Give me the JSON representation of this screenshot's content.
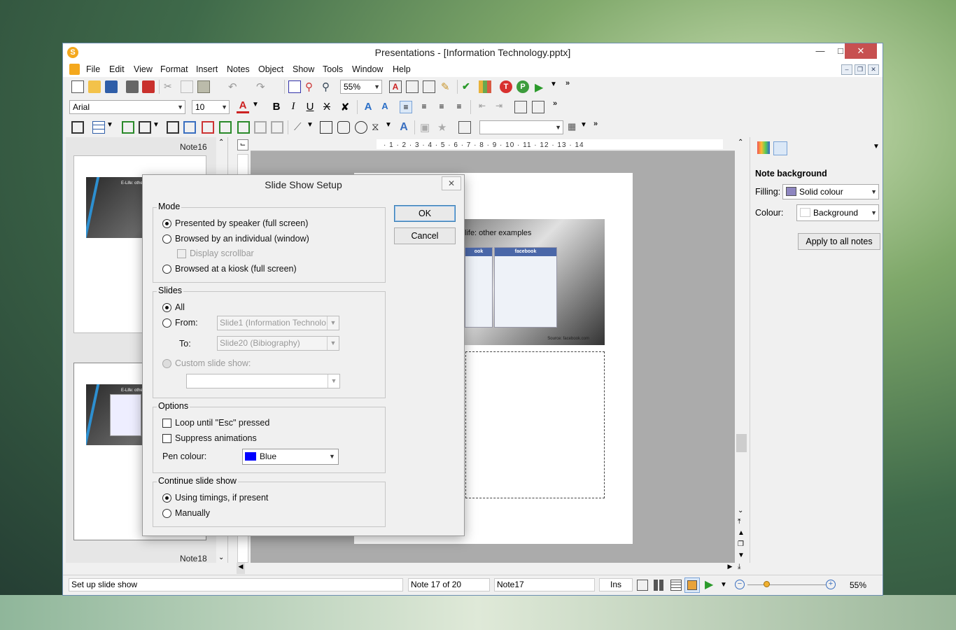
{
  "window": {
    "title": "Presentations - [Information Technology.pptx]",
    "app_icon": "S"
  },
  "menu": [
    "File",
    "Edit",
    "View",
    "Format",
    "Insert",
    "Notes",
    "Object",
    "Show",
    "Tools",
    "Window",
    "Help"
  ],
  "toolbar1": {
    "zoom": "55%"
  },
  "toolbar2": {
    "font": "Arial",
    "size": "10"
  },
  "left_pane": {
    "top_label": "Note16",
    "bottom_label": "Note18",
    "thumb1_title": "E-Life: other",
    "thumb2_title": "E-Life: othe"
  },
  "slide": {
    "title": "life: other examples",
    "fb_left_head": "ook",
    "fb_right_head": "facebook",
    "source": "Source: facebook.com"
  },
  "right_pane": {
    "heading": "Note background",
    "filling_label": "Filling:",
    "filling_value": "Solid colour",
    "colour_label": "Colour:",
    "colour_value": "Background",
    "apply_button": "Apply to all notes"
  },
  "dialog": {
    "title": "Slide Show Setup",
    "ok": "OK",
    "cancel": "Cancel",
    "mode": {
      "legend": "Mode",
      "opt1": "Presented by speaker (full screen)",
      "opt2": "Browsed by an individual (window)",
      "opt2_sub": "Display scrollbar",
      "opt3": "Browsed at a kiosk (full screen)"
    },
    "slides": {
      "legend": "Slides",
      "all": "All",
      "from": "From:",
      "from_value": "Slide1 (Information Technolo",
      "to": "To:",
      "to_value": "Slide20 (Bibiography)",
      "custom": "Custom slide show:"
    },
    "options": {
      "legend": "Options",
      "loop": "Loop until \"Esc\" pressed",
      "suppress": "Suppress animations",
      "pen_label": "Pen colour:",
      "pen_value": "Blue",
      "pen_color": "#0000ff"
    },
    "continue": {
      "legend": "Continue slide show",
      "opt1": "Using timings, if present",
      "opt2": "Manually"
    }
  },
  "status": {
    "message": "Set up slide show",
    "note_pos": "Note 17 of 20",
    "note_name": "Note17",
    "ins": "Ins",
    "zoom": "55%"
  },
  "colors": {
    "filling_swatch": "#8e86c0",
    "accent_blue": "#2d8fd0"
  }
}
